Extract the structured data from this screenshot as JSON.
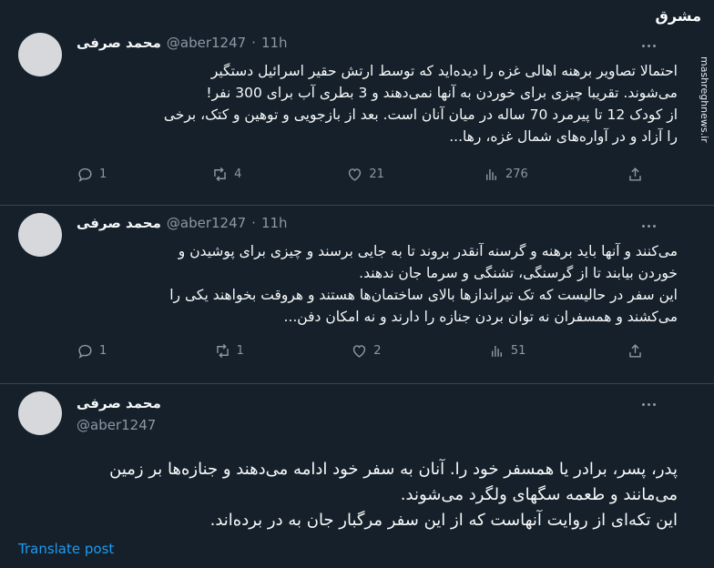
{
  "site_logo": "مشرق",
  "site_watermark": "mashreghnews.ir",
  "tweets": [
    {
      "author_name": "محمد صرفی",
      "handle": "@aber1247",
      "time": "11h",
      "lines": [
        "احتمالا تصاویر برهنه اهالی غزه را دیده‌اید که توسط ارتش حقیر اسرائیل دستگیر",
        "می‌شوند. تقریبا چیزی برای خوردن به آنها نمی‌دهند و 3 بطری آب برای 300 نفر!",
        "از کودک 12 تا پیرمرد 70 ساله در میان آنان است. بعد از بازجویی و توهین و کتک، برخی",
        "را آزاد و در آواره‌های شمال غزه، رها..."
      ],
      "replies": "1",
      "reposts": "4",
      "likes": "21",
      "views": "276"
    },
    {
      "author_name": "محمد صرفی",
      "handle": "@aber1247",
      "time": "11h",
      "lines": [
        "می‌کنند و آنها باید برهنه و گرسنه آنقدر بروند تا به جایی برسند و چیزی برای پوشیدن و",
        "خوردن بیابند تا از گرسنگی، تشنگی و سرما جان ندهند.",
        "این سفر در حالیست که تک تیراندازها بالای ساختمان‌ها هستند و هروقت بخواهند یکی را",
        "می‌کشند و همسفران نه توان بردن جنازه را دارند و نه امکان دفن..."
      ],
      "replies": "1",
      "reposts": "1",
      "likes": "2",
      "views": "51"
    },
    {
      "author_name": "محمد صرفی",
      "handle": "@aber1247",
      "lines": [
        "پدر، پسر، برادر یا همسفر خود را. آنان به سفر خود ادامه می‌دهند و جنازه‌ها بر زمین",
        "می‌مانند و طعمه سگهای ولگرد می‌شوند.",
        "این تکه‌ای از روایت آنهاست که از این سفر مرگبار جان به در برده‌اند."
      ],
      "translate_label": "Translate post"
    }
  ]
}
